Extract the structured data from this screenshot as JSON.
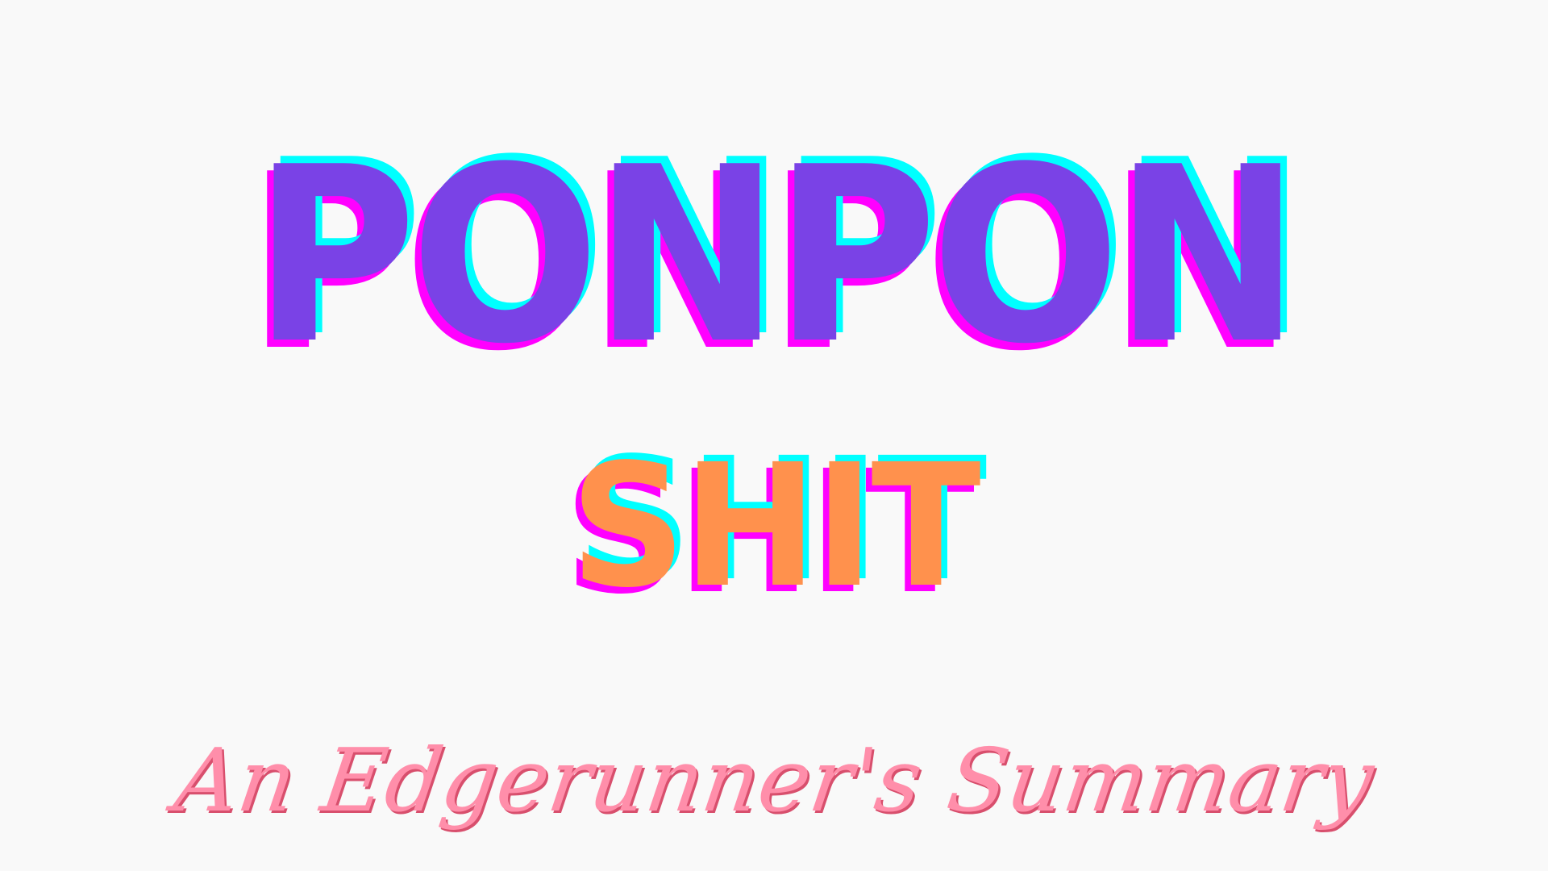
{
  "title": {
    "line1": "PONPON",
    "line2": "SHIT",
    "subtitle": "An Edgerunner's Summary"
  },
  "colors": {
    "background": "#f9f9f9",
    "line1_fill": "#7a42e6",
    "line2_fill": "#ff914d",
    "shadow_cyan": "#00ffff",
    "shadow_magenta": "#ff00ff",
    "subtitle_fill": "#ff8eaa",
    "subtitle_shadow": "#d84f6d"
  }
}
